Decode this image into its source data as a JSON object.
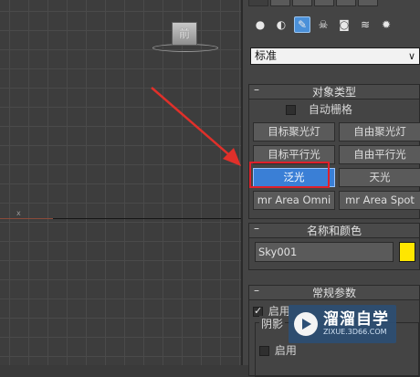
{
  "viewport": {
    "axis_label": "x",
    "view_cube_label": "前"
  },
  "panel": {
    "categories": [
      {
        "icon": "geometry-icon",
        "glyph": "●",
        "active": false
      },
      {
        "icon": "shapes-icon",
        "glyph": "◐",
        "active": false
      },
      {
        "icon": "lights-icon",
        "glyph": "✎",
        "active": true
      },
      {
        "icon": "cameras-icon",
        "glyph": "☠",
        "active": false
      },
      {
        "icon": "helpers-icon",
        "glyph": "◙",
        "active": false
      },
      {
        "icon": "spacewarps-icon",
        "glyph": "≋",
        "active": false
      },
      {
        "icon": "systems-icon",
        "glyph": "✹",
        "active": false
      }
    ],
    "type_dropdown": {
      "value": "标准"
    },
    "object_type": {
      "title": "对象类型",
      "toggle": "–",
      "autogrid_label": "自动栅格",
      "autogrid_checked": false,
      "buttons": [
        {
          "label": "目标聚光灯",
          "selected": false
        },
        {
          "label": "自由聚光灯",
          "selected": false
        },
        {
          "label": "目标平行光",
          "selected": false
        },
        {
          "label": "自由平行光",
          "selected": false
        },
        {
          "label": "泛光",
          "selected": true
        },
        {
          "label": "天光",
          "selected": false
        },
        {
          "label": "mr Area Omni",
          "selected": false
        },
        {
          "label": "mr Area Spot",
          "selected": false
        }
      ]
    },
    "name_color": {
      "title": "名称和颜色",
      "toggle": "–",
      "name_value": "Sky001",
      "color": "#ffe600"
    },
    "general_params": {
      "title": "常规参数",
      "toggle": "–",
      "enable_label": "启用",
      "enable_checked": true,
      "shadow_group_label": "阴影",
      "shadow_enable_label": "启用",
      "shadow_enable_checked": false
    }
  },
  "watermark": {
    "title": "溜溜自学",
    "subtitle": "ZIXUE.3D66.COM"
  },
  "colors": {
    "accent": "#3a7fd6",
    "highlight_box": "#e0202a",
    "arrow": "#e0302a"
  }
}
